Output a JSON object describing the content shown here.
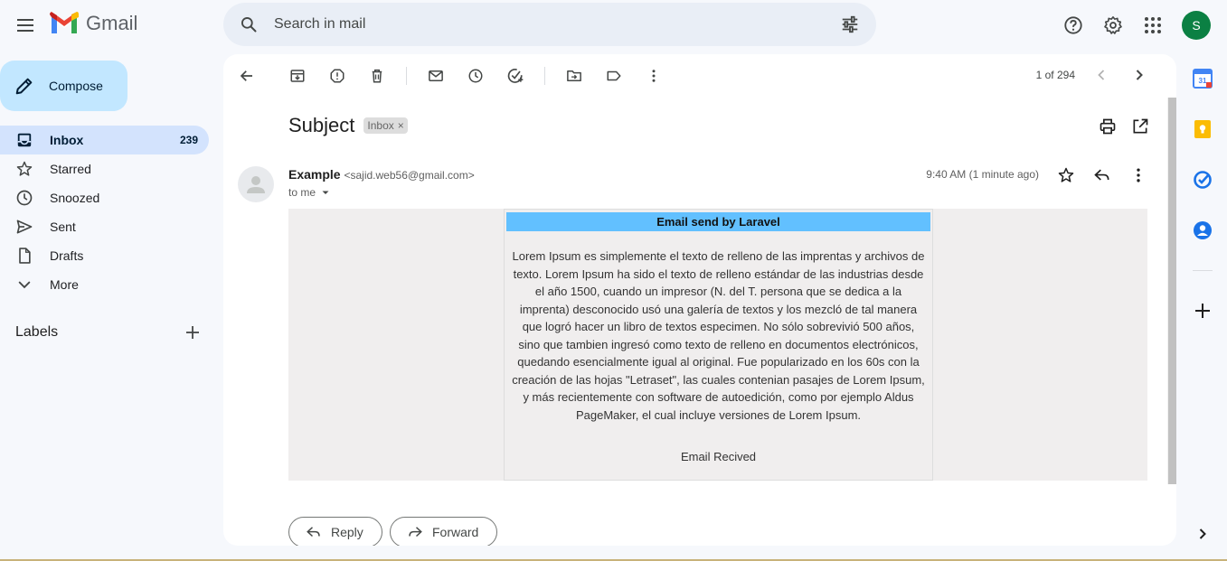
{
  "app": {
    "name": "Gmail"
  },
  "search": {
    "placeholder": "Search in mail"
  },
  "account": {
    "initial": "S",
    "color": "#0b8043"
  },
  "compose": {
    "label": "Compose"
  },
  "nav": [
    {
      "label": "Inbox",
      "count": "239",
      "icon": "inbox-icon",
      "active": true
    },
    {
      "label": "Starred",
      "icon": "star-icon"
    },
    {
      "label": "Snoozed",
      "icon": "clock-icon"
    },
    {
      "label": "Sent",
      "icon": "send-icon"
    },
    {
      "label": "Drafts",
      "icon": "draft-icon"
    },
    {
      "label": "More",
      "icon": "chevron-down-icon"
    }
  ],
  "labels": {
    "title": "Labels"
  },
  "pager": {
    "text": "1 of 294"
  },
  "message": {
    "subject": "Subject",
    "badge": "Inbox",
    "sender_name": "Example",
    "sender_email": "<sajid.web56@gmail.com>",
    "to": "to me",
    "time": "9:40 AM (1 minute ago)"
  },
  "email": {
    "title": "Email send by Laravel",
    "body": "Lorem Ipsum es simplemente el texto de relleno de las imprentas y archivos de texto. Lorem Ipsum ha sido el texto de relleno estándar de las industrias desde el año 1500, cuando un impresor (N. del T. persona que se dedica a la imprenta) desconocido usó una galería de textos y los mezcló de tal manera que logró hacer un libro de textos especimen. No sólo sobrevivió 500 años, sino que tambien ingresó como texto de relleno en documentos electrónicos, quedando esencialmente igual al original. Fue popularizado en los 60s con la creación de las hojas \"Letraset\", las cuales contenian pasajes de Lorem Ipsum, y más recientemente con software de autoedición, como por ejemplo Aldus PageMaker, el cual incluye versiones de Lorem Ipsum.",
    "footer": "Email Recived",
    "title_bg": "#62c0ff"
  },
  "actions": {
    "reply": "Reply",
    "forward": "Forward"
  },
  "colors": {
    "compose_bg": "#c2e7ff",
    "active_nav_bg": "#d3e3fd",
    "page_bg": "#f6f8fc"
  }
}
